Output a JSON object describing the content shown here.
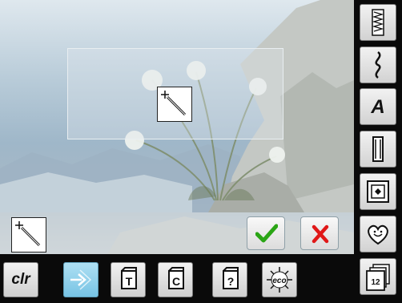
{
  "colors": {
    "accent_blue": "#7cc6e6",
    "confirm_green": "#2aa515",
    "cancel_red": "#e01818",
    "toolbar_bg": "#0a0a0a"
  },
  "bottom_toolbar": {
    "clr_label": "clr",
    "buttons": [
      {
        "name": "clr",
        "label": "clr"
      },
      {
        "name": "move",
        "icon": "arrow-move-icon",
        "selected": true
      },
      {
        "name": "text-t",
        "icon": "stitch-t-icon",
        "letter": "T"
      },
      {
        "name": "text-c",
        "icon": "stitch-c-icon",
        "letter": "C"
      },
      {
        "name": "help",
        "icon": "help-icon",
        "letter": "?"
      },
      {
        "name": "eco",
        "icon": "eco-icon",
        "label": "eco"
      }
    ]
  },
  "sidebar": {
    "alphabet_label": "A",
    "memory_label": "12",
    "buttons": [
      {
        "name": "zigzag",
        "icon": "zigzag-stitch-icon"
      },
      {
        "name": "decorative",
        "icon": "decorative-stitch-icon"
      },
      {
        "name": "alphabet",
        "label": "A"
      },
      {
        "name": "buttonhole",
        "icon": "buttonhole-icon"
      },
      {
        "name": "quilt",
        "icon": "quilt-icon"
      },
      {
        "name": "personal",
        "icon": "heart-icon"
      },
      {
        "name": "memory",
        "icon": "memory-icon",
        "label": "12"
      }
    ]
  },
  "preview": {
    "icon": "magic-wand-icon"
  },
  "actions": {
    "confirm_icon": "checkmark-icon",
    "cancel_icon": "close-icon"
  }
}
